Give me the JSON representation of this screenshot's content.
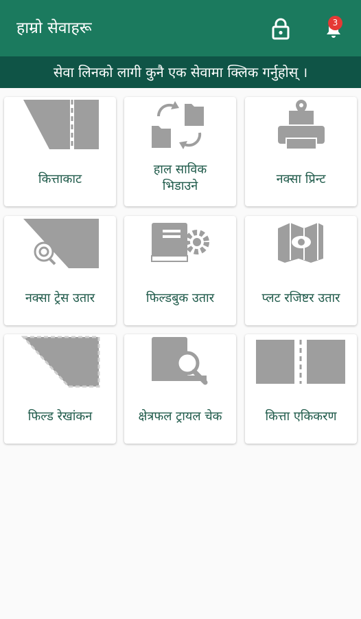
{
  "header": {
    "title": "हाम्रो सेवाहरू",
    "notification_count": "3",
    "colors": {
      "appbar": "#1b7a5e",
      "banner": "#0f5446",
      "badge": "#e53935"
    }
  },
  "banner": {
    "text": "सेवा लिनको लागी कुनै एक सेवामा क्लिक गर्नुहोस् ।"
  },
  "services": [
    {
      "label": "कित्ताकाट",
      "icon": "parcel-split-icon"
    },
    {
      "label": "हाल साविक\nभिडाउने",
      "icon": "swap-files-icon"
    },
    {
      "label": "नक्सा प्रिन्ट",
      "icon": "map-print-icon"
    },
    {
      "label": "नक्सा ट्रेस उतार",
      "icon": "map-trace-icon"
    },
    {
      "label": "फिल्डबुक उतार",
      "icon": "fieldbook-settings-icon"
    },
    {
      "label": "प्लट रजिष्टर उतार",
      "icon": "map-view-icon"
    },
    {
      "label": "फिल्ड रेखांकन",
      "icon": "field-boundary-icon"
    },
    {
      "label": "क्षेत्रफल ट्रायल चेक",
      "icon": "area-search-icon"
    },
    {
      "label": "कित्ता एकिकरण",
      "icon": "parcel-merge-icon"
    }
  ]
}
